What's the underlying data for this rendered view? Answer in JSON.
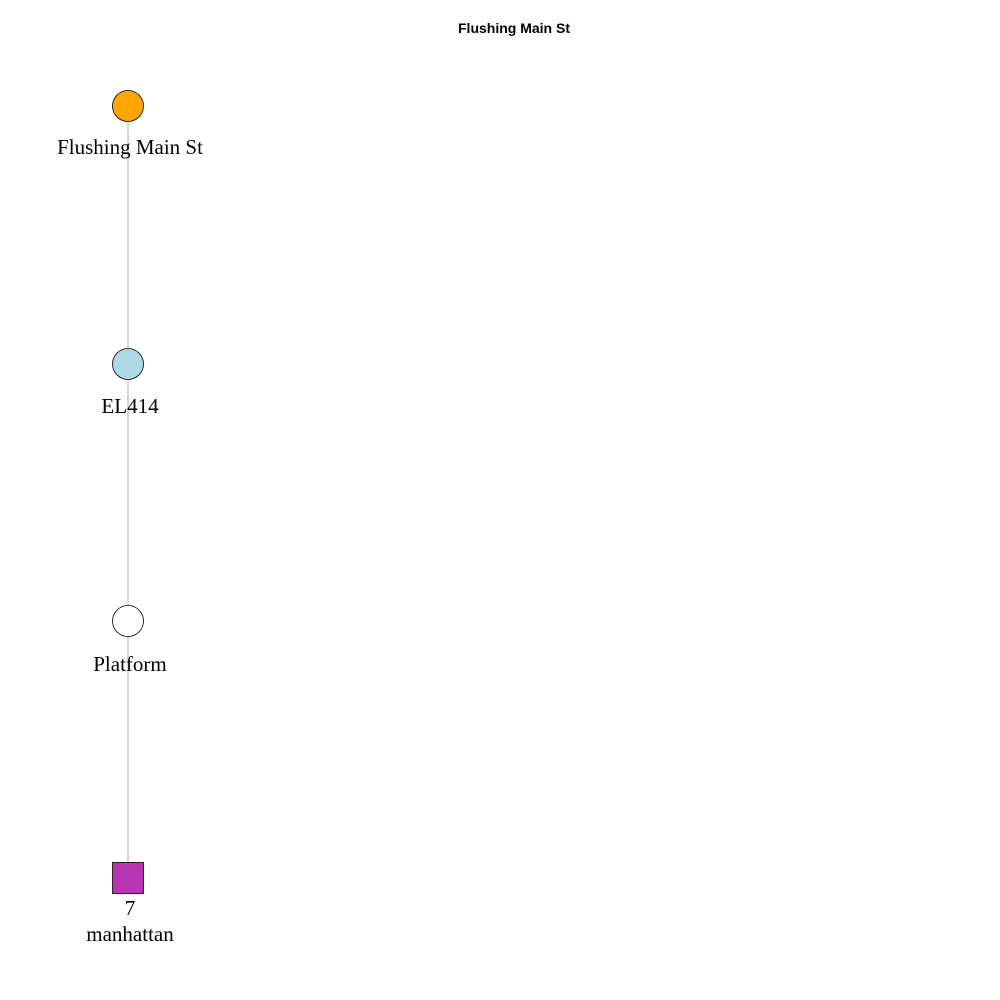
{
  "title": "Flushing Main St",
  "edge_color": "#c8c8c8",
  "nodes": [
    {
      "id": "station",
      "shape": "circle",
      "fill": "#ffa500",
      "label_lines": [
        "Flushing Main St"
      ]
    },
    {
      "id": "elevator",
      "shape": "circle",
      "fill": "#add8e6",
      "label_lines": [
        "EL414"
      ]
    },
    {
      "id": "platform",
      "shape": "circle",
      "fill": "#ffffff",
      "label_lines": [
        "Platform"
      ]
    },
    {
      "id": "route",
      "shape": "square",
      "fill": "#b935b4",
      "label_lines": [
        "7",
        "manhattan"
      ]
    }
  ]
}
